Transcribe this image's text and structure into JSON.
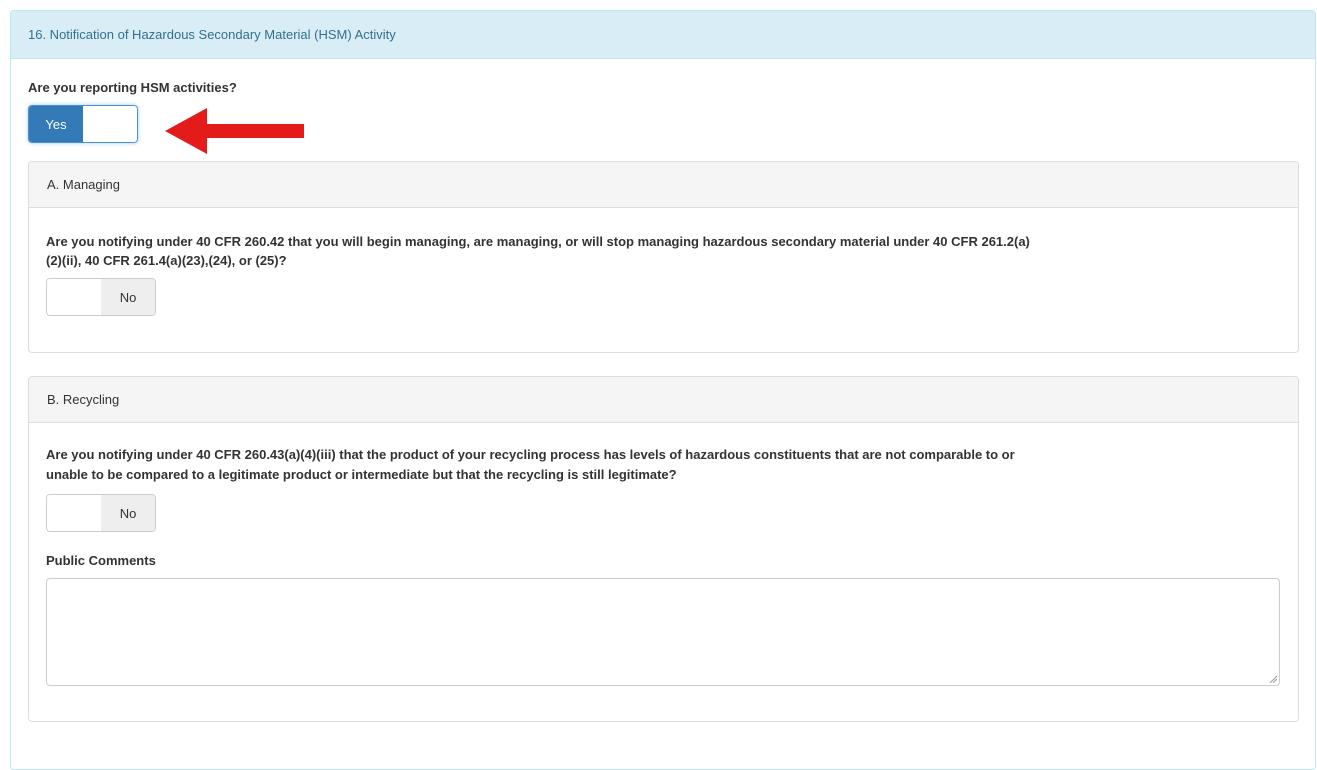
{
  "section": {
    "title": "16. Notification of Hazardous Secondary Material (HSM) Activity",
    "question": "Are you reporting HSM activities?",
    "toggle_label": "Yes"
  },
  "managing": {
    "heading": "A. Managing",
    "question_line1": "Are you notifying under 40 CFR 260.42 that you will begin managing, are managing, or will stop managing hazardous secondary material under 40 CFR 261.2(a)",
    "question_line2": "(2)(ii), 40 CFR 261.4(a)(23),(24), or (25)?",
    "toggle_label": "No"
  },
  "recycling": {
    "heading": "B. Recycling",
    "question_line1": "Are you notifying under 40 CFR 260.43(a)(4)(iii) that the product of your recycling process has levels of hazardous constituents that are not comparable to or",
    "question_line2": "unable to be compared to a legitimate product or intermediate but that the recycling is still legitimate?",
    "toggle_label": "No",
    "comments_label": "Public Comments",
    "comments_value": ""
  },
  "colors": {
    "heading_bg": "#d9edf7",
    "heading_text": "#31708f",
    "toggle_on": "#337ab7",
    "arrow": "#e31b1b"
  }
}
